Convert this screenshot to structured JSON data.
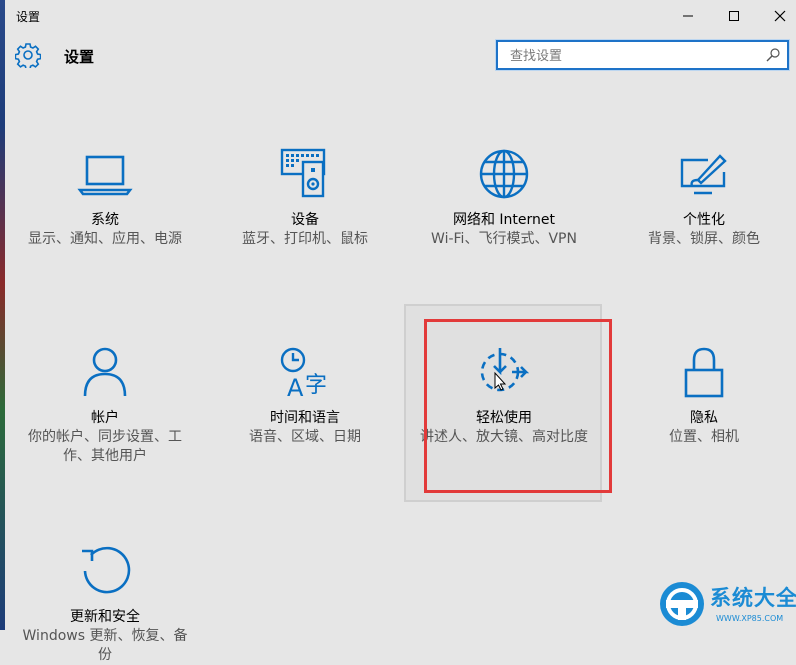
{
  "window": {
    "title": "设置"
  },
  "header": {
    "title": "设置"
  },
  "search": {
    "placeholder": "查找设置"
  },
  "tiles": [
    {
      "title": "系统",
      "desc": "显示、通知、应用、电源",
      "icon": "laptop-icon"
    },
    {
      "title": "设备",
      "desc": "蓝牙、打印机、鼠标",
      "icon": "devices-icon"
    },
    {
      "title": "网络和 Internet",
      "desc": "Wi-Fi、飞行模式、VPN",
      "icon": "globe-icon"
    },
    {
      "title": "个性化",
      "desc": "背景、锁屏、颜色",
      "icon": "personalization-icon"
    },
    {
      "title": "帐户",
      "desc": "你的帐户、同步设置、工作、其他用户",
      "icon": "person-icon"
    },
    {
      "title": "时间和语言",
      "desc": "语音、区域、日期",
      "icon": "time-language-icon"
    },
    {
      "title": "轻松使用",
      "desc": "讲述人、放大镜、高对比度",
      "icon": "ease-of-access-icon"
    },
    {
      "title": "隐私",
      "desc": "位置、相机",
      "icon": "lock-icon"
    },
    {
      "title": "更新和安全",
      "desc": "Windows 更新、恢复、备份",
      "icon": "update-icon"
    }
  ],
  "watermark": {
    "text": "系统大全",
    "url": "WWW.XP85.COM"
  },
  "colors": {
    "accent": "#0a6fc2",
    "highlight_border": "#e23a3a",
    "background": "#e6e6e6"
  }
}
